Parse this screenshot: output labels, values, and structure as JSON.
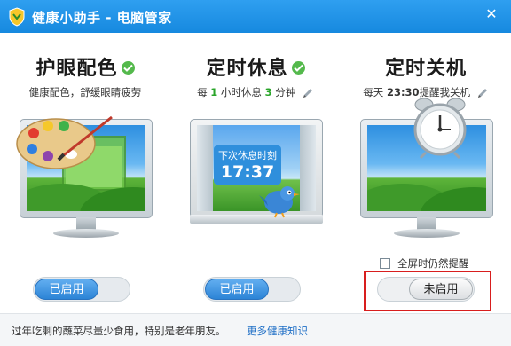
{
  "window": {
    "title": "健康小助手 - 电脑管家",
    "close_symbol": "✕"
  },
  "eye_care": {
    "title": "护眼配色",
    "subtitle": "健康配色，舒缓眼睛疲劳",
    "toggle_label": "已启用",
    "enabled": true
  },
  "break_timer": {
    "title": "定时休息",
    "subtitle_prefix": "每",
    "hours": "1",
    "hours_unit": "小时休息",
    "minutes": "3",
    "minutes_unit": "分钟",
    "next_break_label": "下次休息时刻",
    "next_break_time": "17:37",
    "toggle_label": "已启用",
    "enabled": true
  },
  "shutdown": {
    "title": "定时关机",
    "subtitle_prefix": "每天",
    "time": "23:30",
    "subtitle_suffix": "提醒我关机",
    "fullscreen_option": "全屏时仍然提醒",
    "fullscreen_checked": false,
    "toggle_label": "未启用",
    "enabled": false
  },
  "footer": {
    "tip": "过年吃剩的蘸菜尽量少食用，特别是老年朋友。",
    "more_link": "更多健康知识"
  },
  "colors": {
    "titlebar": "#1f91e6",
    "accent_green": "#2aa52a",
    "toggle_on": "#3b8fdc",
    "highlight_red": "#d81e1e",
    "link": "#1f6fc6"
  }
}
